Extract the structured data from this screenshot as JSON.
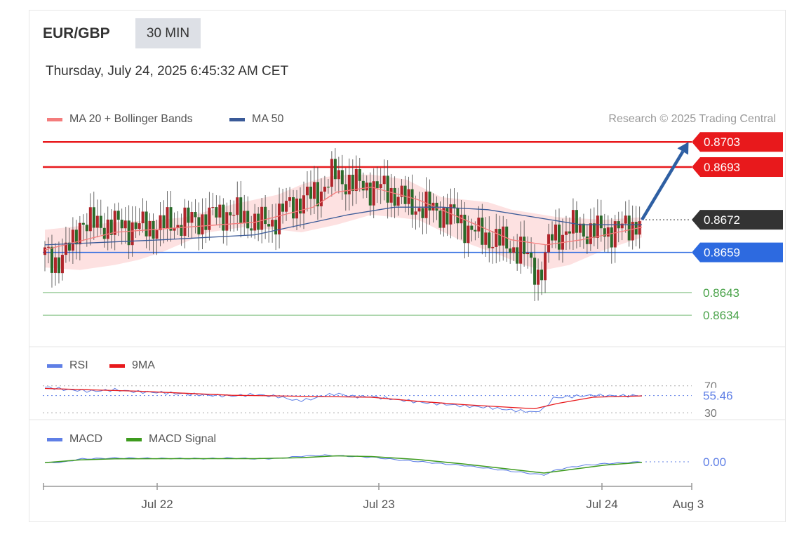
{
  "header": {
    "symbol": "EUR/GBP",
    "timeframe": "30 MIN",
    "datetime": "Thursday, July 24, 2025 6:45:32 AM CET",
    "credit": "Research © 2025 Trading Central"
  },
  "colors": {
    "resistance": "#e8191c",
    "pivot": "#2d6ae0",
    "support": "#4aa34a",
    "last": "#333333",
    "bb_fill": "#fde1e1",
    "ma20": "#f47c7c",
    "ma50": "#3a5a98",
    "arrow": "#2e5fa3",
    "rsi": "#5f7fe6",
    "rsi_ma": "#e8191c",
    "macd": "#5f7fe6",
    "macd_signal": "#3e9b1e",
    "candle_up": "#b0242a",
    "candle_down": "#2a6a2a"
  },
  "chart_data": [
    {
      "type": "candlestick",
      "title": "EUR/GBP",
      "legend": [
        "MA 20 + Bollinger Bands",
        "MA 50"
      ],
      "legend_position": "top-left",
      "ylim": [
        0.8622,
        0.8712
      ],
      "x_ticks": [
        "Jul 22",
        "Jul 23",
        "Jul 24",
        "Aug 3"
      ],
      "levels": [
        {
          "label": "0.8703",
          "value": 0.8703,
          "kind": "resistance"
        },
        {
          "label": "0.8693",
          "value": 0.8693,
          "kind": "resistance"
        },
        {
          "label": "0.8672",
          "value": 0.8672,
          "kind": "last"
        },
        {
          "label": "0.8659",
          "value": 0.8659,
          "kind": "pivot"
        },
        {
          "label": "0.8643",
          "value": 0.8643,
          "kind": "support"
        },
        {
          "label": "0.8634",
          "value": 0.8634,
          "kind": "support"
        }
      ],
      "close_path": [
        [
          0,
          0.8658
        ],
        [
          4,
          0.8655
        ],
        [
          8,
          0.8658
        ],
        [
          12,
          0.8662
        ],
        [
          15,
          0.8672
        ],
        [
          20,
          0.867
        ],
        [
          30,
          0.867
        ],
        [
          40,
          0.8669
        ],
        [
          50,
          0.867
        ],
        [
          60,
          0.8671
        ],
        [
          70,
          0.8673
        ],
        [
          78,
          0.8675
        ],
        [
          86,
          0.8673
        ],
        [
          92,
          0.867
        ],
        [
          98,
          0.8672
        ],
        [
          104,
          0.8677
        ],
        [
          110,
          0.868
        ],
        [
          116,
          0.8682
        ],
        [
          120,
          0.8686
        ],
        [
          124,
          0.869
        ],
        [
          128,
          0.8688
        ],
        [
          134,
          0.8686
        ],
        [
          140,
          0.8685
        ],
        [
          146,
          0.8684
        ],
        [
          152,
          0.8682
        ],
        [
          156,
          0.8678
        ],
        [
          162,
          0.8677
        ],
        [
          170,
          0.8675
        ],
        [
          176,
          0.8673
        ],
        [
          180,
          0.867
        ],
        [
          186,
          0.8666
        ],
        [
          194,
          0.8664
        ],
        [
          198,
          0.8662
        ],
        [
          204,
          0.866
        ],
        [
          208,
          0.8655
        ],
        [
          212,
          0.865
        ],
        [
          214,
          0.8655
        ],
        [
          217,
          0.8665
        ],
        [
          222,
          0.8667
        ],
        [
          228,
          0.8669
        ],
        [
          234,
          0.8667
        ],
        [
          240,
          0.8668
        ],
        [
          246,
          0.8668
        ],
        [
          252,
          0.867
        ],
        [
          256,
          0.8672
        ]
      ],
      "ma20": [
        [
          0,
          0.866
        ],
        [
          30,
          0.8667
        ],
        [
          60,
          0.8669
        ],
        [
          90,
          0.8671
        ],
        [
          115,
          0.8677
        ],
        [
          125,
          0.8683
        ],
        [
          140,
          0.8685
        ],
        [
          160,
          0.868
        ],
        [
          180,
          0.8672
        ],
        [
          200,
          0.8664
        ],
        [
          215,
          0.8662
        ],
        [
          230,
          0.8664
        ],
        [
          256,
          0.8669
        ]
      ],
      "bb_upper": [
        [
          0,
          0.8668
        ],
        [
          30,
          0.8671
        ],
        [
          50,
          0.8672
        ],
        [
          60,
          0.8673
        ],
        [
          80,
          0.8678
        ],
        [
          100,
          0.8682
        ],
        [
          110,
          0.8686
        ],
        [
          120,
          0.8689
        ],
        [
          130,
          0.869
        ],
        [
          140,
          0.869
        ],
        [
          155,
          0.8688
        ],
        [
          170,
          0.8681
        ],
        [
          180,
          0.868
        ],
        [
          190,
          0.8679
        ],
        [
          200,
          0.8676
        ],
        [
          220,
          0.8673
        ],
        [
          240,
          0.8672
        ],
        [
          256,
          0.8673
        ]
      ],
      "bb_lower": [
        [
          256,
          0.8665
        ],
        [
          240,
          0.866
        ],
        [
          225,
          0.8654
        ],
        [
          214,
          0.8652
        ],
        [
          205,
          0.8654
        ],
        [
          195,
          0.8658
        ],
        [
          180,
          0.8663
        ],
        [
          160,
          0.8672
        ],
        [
          140,
          0.8674
        ],
        [
          125,
          0.867
        ],
        [
          110,
          0.8667
        ],
        [
          100,
          0.8668
        ],
        [
          85,
          0.8669
        ],
        [
          70,
          0.8667
        ],
        [
          50,
          0.8659
        ],
        [
          40,
          0.8656
        ],
        [
          30,
          0.8654
        ],
        [
          15,
          0.8652
        ],
        [
          0,
          0.8653
        ]
      ],
      "ma50": [
        [
          0,
          0.8662
        ],
        [
          50,
          0.8664
        ],
        [
          90,
          0.8666
        ],
        [
          110,
          0.867
        ],
        [
          130,
          0.8674
        ],
        [
          150,
          0.8677
        ],
        [
          170,
          0.8677
        ],
        [
          190,
          0.8676
        ],
        [
          210,
          0.8673
        ],
        [
          230,
          0.867
        ],
        [
          256,
          0.867
        ]
      ],
      "forecast_arrow": {
        "from": [
          256,
          0.8672
        ],
        "to": [
          276,
          0.8703
        ]
      }
    },
    {
      "type": "line",
      "legend": [
        "RSI",
        "9MA"
      ],
      "legend_position": "top-left",
      "ylim": [
        26,
        78
      ],
      "reference_levels": [
        70,
        55.46,
        30
      ],
      "value_label": "55.46",
      "tick_labels": [
        "70",
        "30"
      ],
      "rsi": [
        [
          0,
          68
        ],
        [
          10,
          64
        ],
        [
          20,
          62
        ],
        [
          30,
          64
        ],
        [
          40,
          61
        ],
        [
          50,
          60
        ],
        [
          60,
          58
        ],
        [
          70,
          56
        ],
        [
          80,
          55
        ],
        [
          90,
          57
        ],
        [
          100,
          54
        ],
        [
          108,
          48
        ],
        [
          114,
          50
        ],
        [
          120,
          56
        ],
        [
          126,
          58
        ],
        [
          132,
          54
        ],
        [
          140,
          54
        ],
        [
          150,
          50
        ],
        [
          160,
          46
        ],
        [
          170,
          43
        ],
        [
          180,
          40
        ],
        [
          190,
          38
        ],
        [
          200,
          34
        ],
        [
          210,
          31
        ],
        [
          214,
          36
        ],
        [
          218,
          52
        ],
        [
          225,
          54
        ],
        [
          235,
          56
        ],
        [
          245,
          55
        ],
        [
          256,
          55.46
        ]
      ],
      "rsi_ma": [
        [
          0,
          66
        ],
        [
          20,
          64
        ],
        [
          40,
          62
        ],
        [
          60,
          59
        ],
        [
          80,
          56
        ],
        [
          100,
          55
        ],
        [
          120,
          54
        ],
        [
          140,
          53
        ],
        [
          160,
          47
        ],
        [
          180,
          42
        ],
        [
          200,
          38
        ],
        [
          210,
          36
        ],
        [
          220,
          44
        ],
        [
          235,
          53
        ],
        [
          256,
          55
        ]
      ]
    },
    {
      "type": "line",
      "legend": [
        "MACD",
        "MACD Signal"
      ],
      "legend_position": "top-left",
      "ylim": [
        -0.0012,
        0.0006
      ],
      "reference_levels": [
        0
      ],
      "value_label": "0.00",
      "macd": [
        [
          0,
          -5e-05
        ],
        [
          8,
          -2e-05
        ],
        [
          15,
          0.00015
        ],
        [
          30,
          0.0002
        ],
        [
          50,
          0.00018
        ],
        [
          70,
          0.00017
        ],
        [
          80,
          0.0002
        ],
        [
          90,
          0.00016
        ],
        [
          100,
          0.00018
        ],
        [
          110,
          0.0003
        ],
        [
          120,
          0.00035
        ],
        [
          130,
          0.0003
        ],
        [
          140,
          0.00025
        ],
        [
          150,
          0.00012
        ],
        [
          160,
          2e-05
        ],
        [
          170,
          -0.0001
        ],
        [
          180,
          -0.0002
        ],
        [
          190,
          -0.00035
        ],
        [
          200,
          -0.0005
        ],
        [
          210,
          -0.00065
        ],
        [
          214,
          -0.0007
        ],
        [
          220,
          -0.0004
        ],
        [
          230,
          -0.0002
        ],
        [
          240,
          -0.0001
        ],
        [
          256,
          0.0
        ]
      ],
      "macd_signal": [
        [
          0,
          -5e-05
        ],
        [
          15,
          0.0001
        ],
        [
          30,
          0.00016
        ],
        [
          60,
          0.00017
        ],
        [
          90,
          0.00017
        ],
        [
          110,
          0.00022
        ],
        [
          125,
          0.00032
        ],
        [
          140,
          0.00028
        ],
        [
          160,
          0.00012
        ],
        [
          180,
          -0.00012
        ],
        [
          200,
          -0.0004
        ],
        [
          214,
          -0.0006
        ],
        [
          225,
          -0.00042
        ],
        [
          240,
          -0.00018
        ],
        [
          256,
          -3e-05
        ]
      ]
    }
  ]
}
